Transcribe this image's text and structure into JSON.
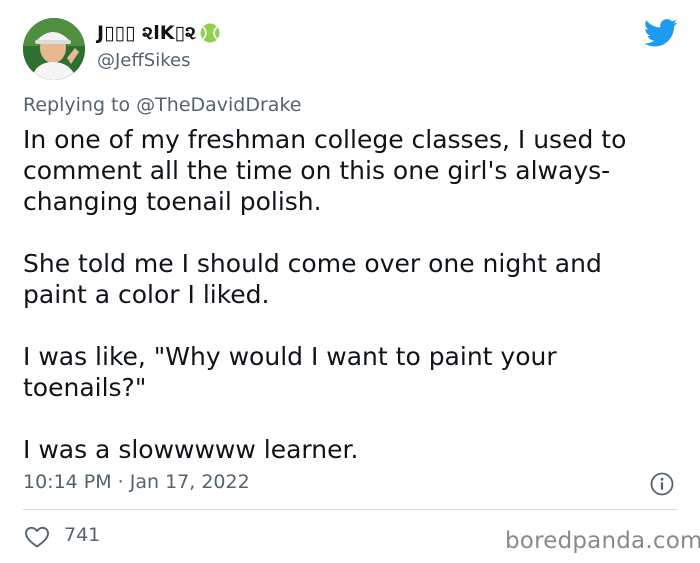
{
  "tweet": {
    "display_name": "J▯▯▯ ૨lK▯૨",
    "handle": "@JeffSikes",
    "reply_prefix": "Replying to",
    "reply_to": "@TheDavidDrake",
    "paragraphs": [
      "In one of my freshman college classes, I used to\ncomment all the time on this one girl's always-\nchanging toenail polish.",
      "She told me I should come over one night and\npaint a color I liked.",
      "I was like, \"Why would I want to paint your\ntoenails?\"",
      "I was a slowwwww learner."
    ],
    "timestamp": "10:14 PM · Jan 17, 2022",
    "like_count": "741"
  },
  "icons": {
    "name_emoji": "tennis-ball-icon",
    "brand": "twitter-bird-icon",
    "info": "info-icon",
    "like": "heart-icon"
  },
  "watermark": "boredpanda.com",
  "colors": {
    "twitter_blue": "#1d9bf0",
    "secondary_text": "#536471",
    "primary_text": "#0f1419",
    "tennis_ball": "#8fd14f"
  }
}
